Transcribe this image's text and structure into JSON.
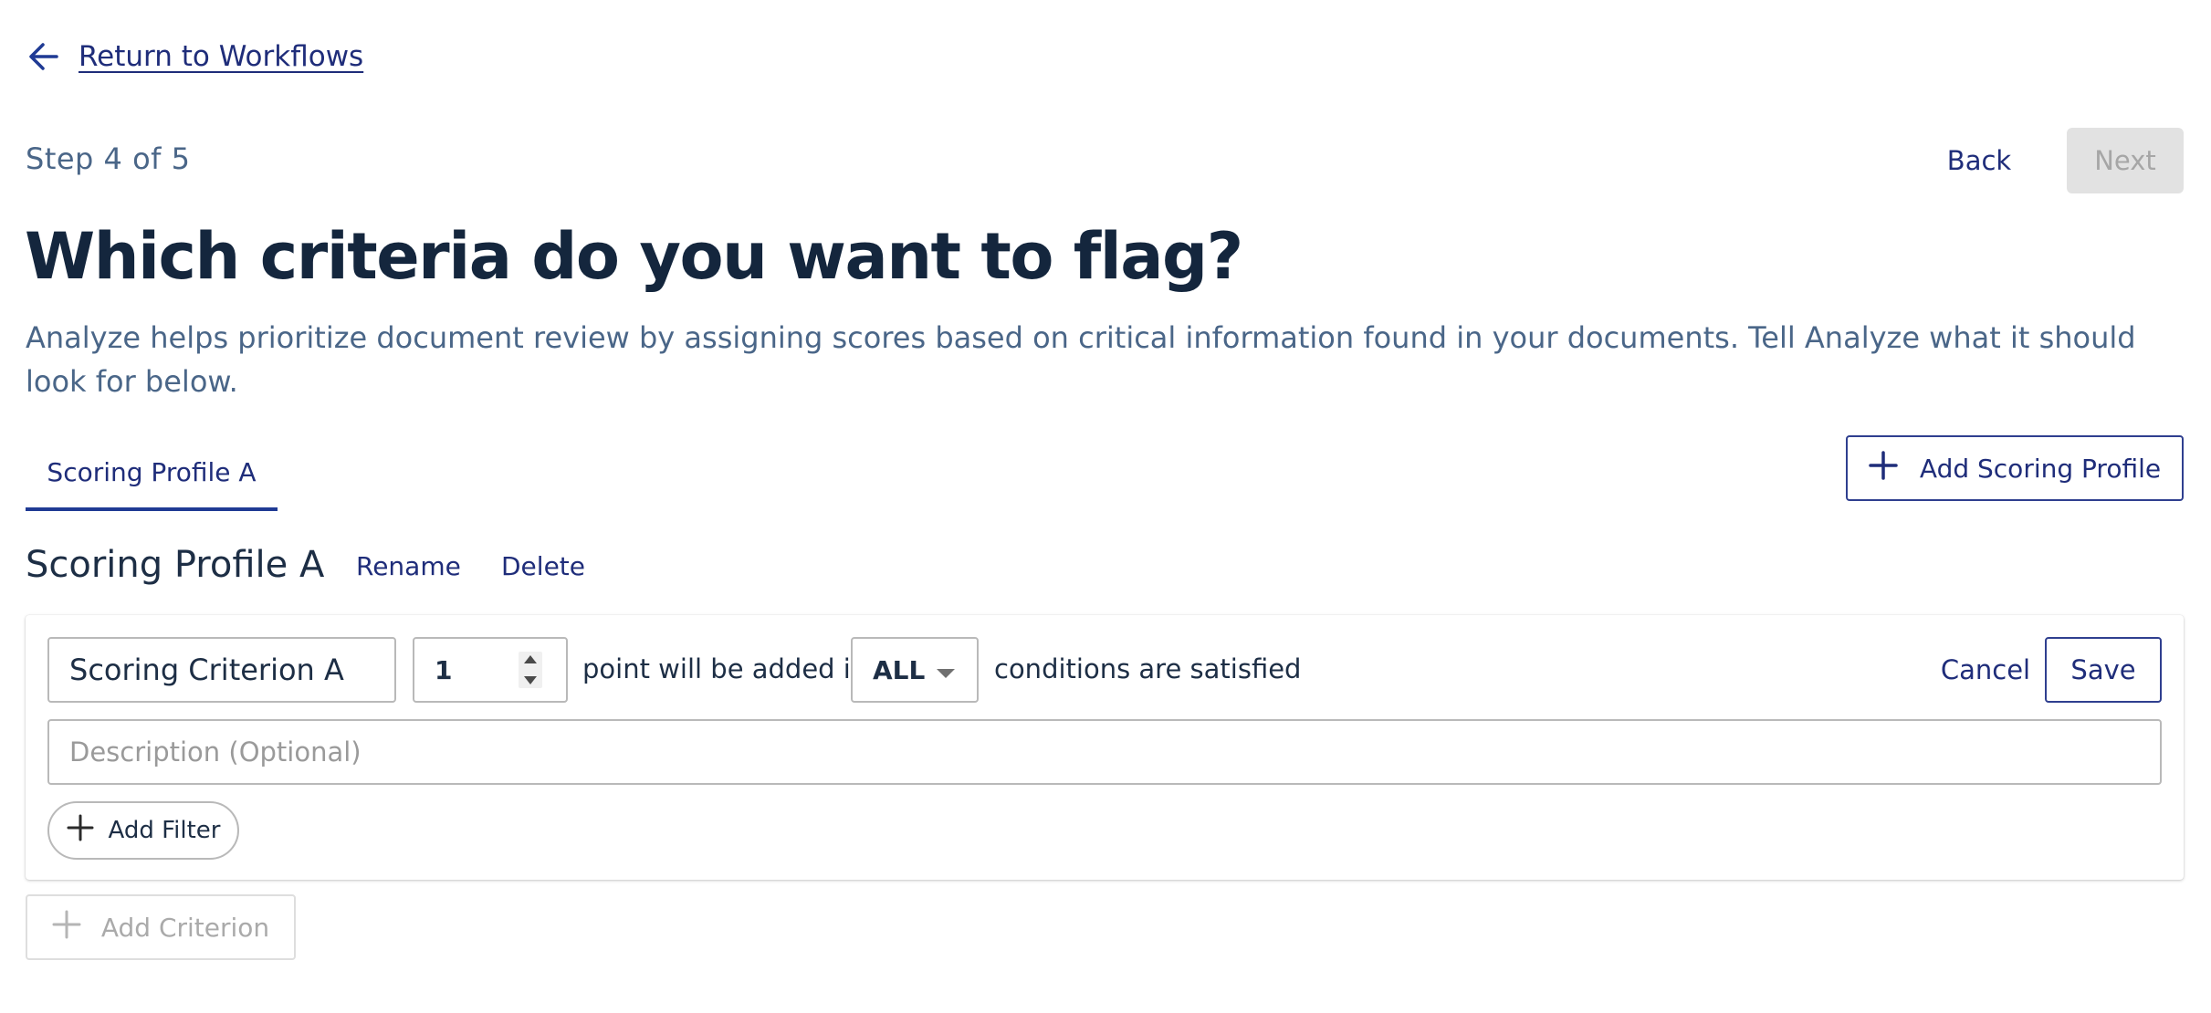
{
  "nav": {
    "return_label": "Return to Workflows"
  },
  "wizard": {
    "step_label": "Step 4 of 5",
    "back_label": "Back",
    "next_label": "Next"
  },
  "header": {
    "title": "Which criteria do you want to flag?",
    "description": "Analyze helps prioritize document review by assigning scores based on critical information found in your documents. Tell Analyze what it should look for below."
  },
  "tabs": [
    {
      "label": "Scoring Profile A",
      "active": true
    }
  ],
  "add_profile_label": "Add Scoring Profile",
  "profile": {
    "name": "Scoring Profile A",
    "rename_label": "Rename",
    "delete_label": "Delete"
  },
  "criterion": {
    "name_value": "Scoring Criterion A",
    "points_value": "1",
    "points_text": "point will be added if",
    "match_value": "ALL",
    "conditions_text": "conditions are satisfied",
    "cancel_label": "Cancel",
    "save_label": "Save",
    "description_placeholder": "Description (Optional)",
    "add_filter_label": "Add Filter"
  },
  "add_criterion_label": "Add Criterion",
  "colors": {
    "primary": "#1f2d7a",
    "heading": "#14263d",
    "muted_text": "#4a6688",
    "disabled_bg": "#e2e2e2",
    "disabled_text": "#a6a6a6"
  },
  "icons": {
    "return": "arrow-left-icon",
    "add": "plus-icon",
    "spinner": "spinner-arrows-icon",
    "dropdown": "caret-down-icon"
  }
}
